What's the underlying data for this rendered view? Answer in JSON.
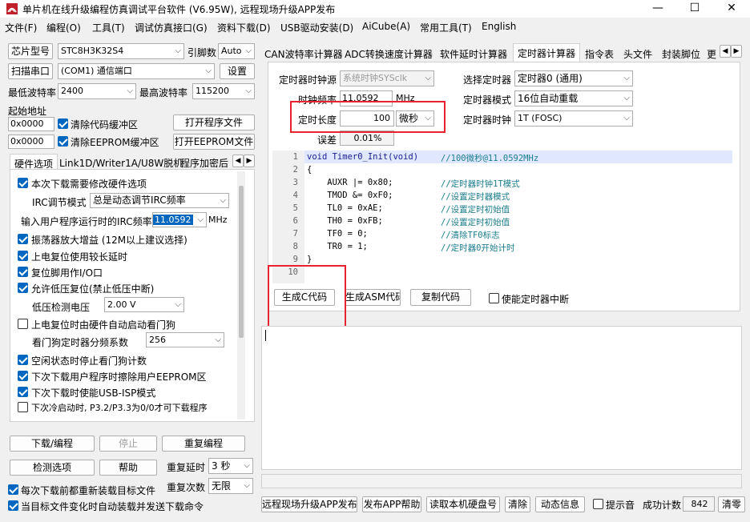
{
  "window": {
    "title": "单片机在线升级编程仿真调试平台软件 (V6.95W), 远程现场升级APP发布",
    "min": "—",
    "max": "☐",
    "close": "✕"
  },
  "menu": [
    "文件(F)",
    "编程(O)",
    "工具(T)",
    "调试仿真接口(G)",
    "资料下载(D)",
    "USB驱动安装(D)",
    "AiCube(A)",
    "常用工具(T)",
    "English"
  ],
  "left": {
    "chip_label": "芯片型号",
    "chip_value": "STC8H3K32S4",
    "pin_label": "引脚数",
    "pin_value": "Auto",
    "scan_port_btn": "扫描串口",
    "port_value": "(COM1) 通信端口",
    "settings_btn": "设置",
    "min_baud_label": "最低波特率",
    "min_baud_value": "2400",
    "max_baud_label": "最高波特率",
    "max_baud_value": "115200",
    "start_addr_label": "起始地址",
    "addr1": "0x0000",
    "clear_code_buf": "清除代码缓冲区",
    "open_prog_btn": "打开程序文件",
    "addr2": "0x0000",
    "clear_eeprom_buf": "清除EEPROM缓冲区",
    "open_eeprom_btn": "打开EEPROM文件",
    "tabs": [
      "硬件选项",
      "Link1D/Writer1A/U8W脱机",
      "程序加密后"
    ],
    "options": [
      {
        "label": "本次下载需要修改硬件选项",
        "checked": true
      },
      {
        "label": "振荡器放大增益 (12M以上建议选择)",
        "checked": true
      },
      {
        "label": "上电复位使用较长延时",
        "checked": true
      },
      {
        "label": "复位脚用作I/O口",
        "checked": true
      },
      {
        "label": "允许低压复位(禁止低压中断)",
        "checked": true
      },
      {
        "label": "上电复位时由硬件自动启动看门狗",
        "checked": false
      },
      {
        "label": "空闲状态时停止看门狗计数",
        "checked": true
      },
      {
        "label": "下次下载用户程序时擦除用户EEPROM区",
        "checked": true
      },
      {
        "label": "下次下载时使能USB-ISP模式",
        "checked": true
      },
      {
        "label": "下次冷启动时, P3.2/P3.3为0/0才可下载程序",
        "checked": false
      }
    ],
    "irc_mode_label": "IRC调节模式",
    "irc_mode_value": "总是动态调节IRC频率",
    "irc_freq_label": "输入用户程序运行时的IRC频率",
    "irc_freq_value": "11.0592",
    "irc_freq_unit": "MHz",
    "lvd_label": "低压检测电压",
    "lvd_value": "2.00 V",
    "wdt_label": "看门狗定时器分频系数",
    "wdt_value": "256",
    "download_btn": "下载/编程",
    "stop_btn": "停止",
    "reprog_btn": "重复编程",
    "detect_btn": "检测选项",
    "help_btn": "帮助",
    "repeat_delay_label": "重复延时",
    "repeat_delay_value": "3 秒",
    "repeat_count_label": "重复次数",
    "repeat_count_value": "无限",
    "reload_chk": "每次下载前都重新装载目标文件",
    "auto_load_chk": "当目标文件变化时自动装载并发送下载命令"
  },
  "right": {
    "tabs": [
      "CAN波特率计算器",
      "ADC转换速度计算器",
      "软件延时计算器",
      "定时器计算器",
      "指令表",
      "头文件",
      "封装脚位",
      "更"
    ],
    "clock_src_label": "定时器时钟源",
    "clock_src_value": "系统时钟SYSclk",
    "sysfreq_label": "时钟频率",
    "sysfreq_value": "11.0592",
    "sysfreq_unit": "MHz",
    "length_label": "定时长度",
    "length_value": "100",
    "length_unit": "微秒",
    "error_label": "误差",
    "error_value": "0.01%",
    "select_timer_label": "选择定时器",
    "select_timer_value": "定时器0 (通用)",
    "timer_mode_label": "定时器模式",
    "timer_mode_value": "16位自动重载",
    "timer_clock_label": "定时器时钟",
    "timer_clock_value": "1T  (FOSC)",
    "code_lines": [
      {
        "n": "1",
        "code": "void Timer0_Init(void)",
        "comment": "//100微秒@11.0592MHz"
      },
      {
        "n": "2",
        "code": "{",
        "comment": ""
      },
      {
        "n": "3",
        "code": "    AUXR |= 0x80;",
        "comment": "//定时器时钟1T模式"
      },
      {
        "n": "4",
        "code": "    TMOD &= 0xF0;",
        "comment": "//设置定时器模式"
      },
      {
        "n": "5",
        "code": "    TL0 = 0xAE;",
        "comment": "//设置定时初始值"
      },
      {
        "n": "6",
        "code": "    TH0 = 0xFB;",
        "comment": "//设置定时初始值"
      },
      {
        "n": "7",
        "code": "    TF0 = 0;",
        "comment": "//清除TF0标志"
      },
      {
        "n": "8",
        "code": "    TR0 = 1;",
        "comment": "//定时器0开始计时"
      },
      {
        "n": "9",
        "code": "}",
        "comment": ""
      },
      {
        "n": "10",
        "code": "",
        "comment": ""
      }
    ],
    "gen_c_btn": "生成C代码",
    "gen_asm_btn": "生成ASM代码",
    "copy_btn": "复制代码",
    "enable_int_chk": "使能定时器中断",
    "bottom": {
      "publish_btn": "远程现场升级APP发布",
      "publish_help_btn": "发布APP帮助",
      "read_disk_btn": "读取本机硬盘号",
      "clear_btn": "清除",
      "dyn_info_btn": "动态信息",
      "beep_chk": "提示音",
      "success_label": "成功计数",
      "success_value": "842",
      "clear_count_btn": "清零"
    }
  }
}
